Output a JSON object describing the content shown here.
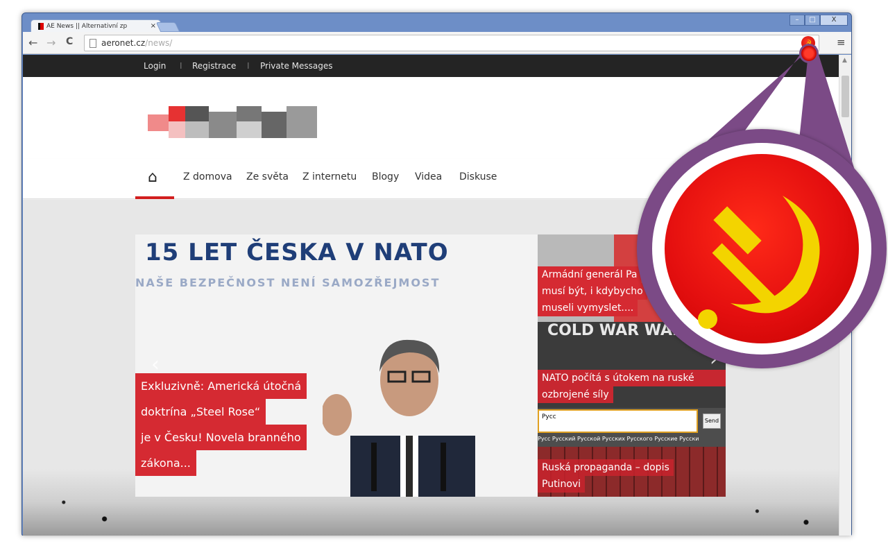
{
  "browser": {
    "tab_title": "AE News || Alternativní zp",
    "tab_close": "×",
    "address": {
      "domain": "aeronet.cz",
      "path": "/news/"
    },
    "window_buttons": [
      "–",
      "□",
      "X"
    ],
    "back_icon": "←",
    "forward_icon": "→",
    "reload_icon": "C",
    "extension_icon": "hammer-and-sickle-icon",
    "menu_icon": "≡"
  },
  "topbar": {
    "items": [
      "Login",
      "Registrace",
      "Private Messages"
    ],
    "separator": "I"
  },
  "main_nav": {
    "home_icon": "⌂",
    "items": [
      "Z domova",
      "Ze světa",
      "Z internetu",
      "Blogy",
      "Videa",
      "Diskuse"
    ]
  },
  "slider": {
    "banner_title": "15 LET ČESKA V NATO",
    "banner_subtitle": "NAŠE BEZPEČNOST NENÍ SAMOZŘEJMOST",
    "caption_lines": [
      "Exkluzivně: Americká útočná",
      "doktrína „Steel Rose“",
      "je v Česku! Novela branného",
      "zákona..."
    ],
    "prev_arrow": "‹",
    "next_arrow": "›"
  },
  "sidebar": {
    "item1_lines": [
      "Armádní generál Pa",
      "musí být, i kdybycho",
      "museli vymyslet...."
    ],
    "item2_image_text": "COLD WAR WAR",
    "item2_lines": [
      "NATO počítá s útokem na ruské",
      "ozbrojené síly"
    ],
    "item3_input_value": "Русс",
    "item3_send": "Send",
    "item3_suggestions": "Русс  Русский  Русской  Русских  Русского  Русские  Русски",
    "item3_lines": [
      "Ruská propaganda – dopis",
      "Putinovi"
    ]
  },
  "colors": {
    "accent_red": "#d52a32",
    "magnifier_purple": "#7b4a86",
    "sickle_yellow": "#f3d400"
  }
}
